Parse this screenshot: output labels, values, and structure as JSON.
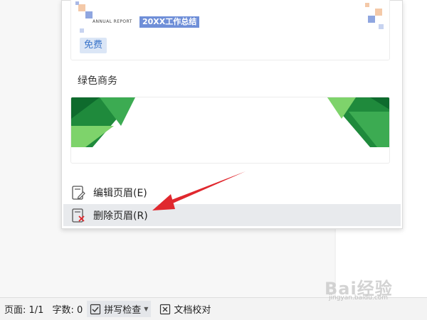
{
  "template_panel": {
    "annual_card": {
      "annual_text": "ANNUAL REPORT",
      "report_title": "20XX工作总结",
      "badge": "免费"
    },
    "green_section": {
      "title": "绿色商务"
    }
  },
  "menu": {
    "edit_header": "编辑页眉(E)",
    "delete_header": "删除页眉(R)"
  },
  "status_bar": {
    "page": "页面: 1/1",
    "word_count": "字数: 0",
    "spell_check": "拼写检查",
    "doc_proofread": "文档校对"
  },
  "watermark": {
    "main": "Bai经验",
    "sub": "jingyan.baidu.com"
  },
  "colors": {
    "accent_blue": "#6f8fd8",
    "badge_bg": "#dbe6f6",
    "badge_text": "#3a74c9",
    "arrow_red": "#e0282e",
    "green_dark": "#1f8a3c",
    "green_light": "#7ed36b"
  }
}
